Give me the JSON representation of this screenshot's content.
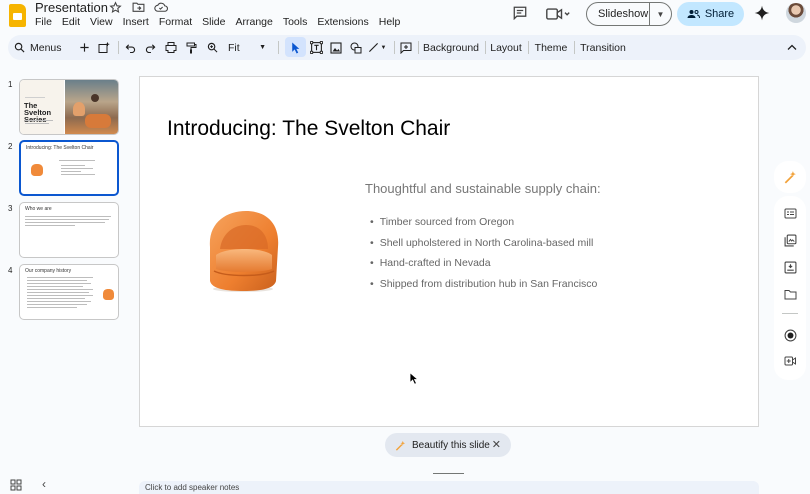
{
  "header": {
    "doc_title": "Presentation",
    "menu": [
      "File",
      "Edit",
      "View",
      "Insert",
      "Format",
      "Slide",
      "Arrange",
      "Tools",
      "Extensions",
      "Help"
    ],
    "slideshow_label": "Slideshow",
    "share_label": "Share"
  },
  "toolbar": {
    "menus_label": "Menus",
    "zoom_label": "Fit",
    "background_label": "Background",
    "layout_label": "Layout",
    "theme_label": "Theme",
    "transition_label": "Transition"
  },
  "filmstrip": [
    {
      "number": "1",
      "title": "The Svelton Series"
    },
    {
      "number": "2",
      "title": "Introducing: The Svelton Chair"
    },
    {
      "number": "3",
      "title": "Who we are"
    },
    {
      "number": "4",
      "title": "Our company history"
    }
  ],
  "slide": {
    "title": "Introducing: The Svelton Chair",
    "subtitle": "Thoughtful and sustainable supply chain:",
    "bullets": [
      "Timber sourced from Oregon",
      "Shell upholstered in North Carolina-based mill",
      "Hand-crafted in Nevada",
      "Shipped from distribution hub in San Francisco"
    ]
  },
  "beautify_label": "Beautify this slide",
  "notes_placeholder": "Click to add speaker notes",
  "colors": {
    "accent": "#0b57d0",
    "share_bg": "#c2e7ff",
    "toolbar_bg": "#edf2fa",
    "logo": "#f6b400",
    "chair": "#f08a3a"
  }
}
